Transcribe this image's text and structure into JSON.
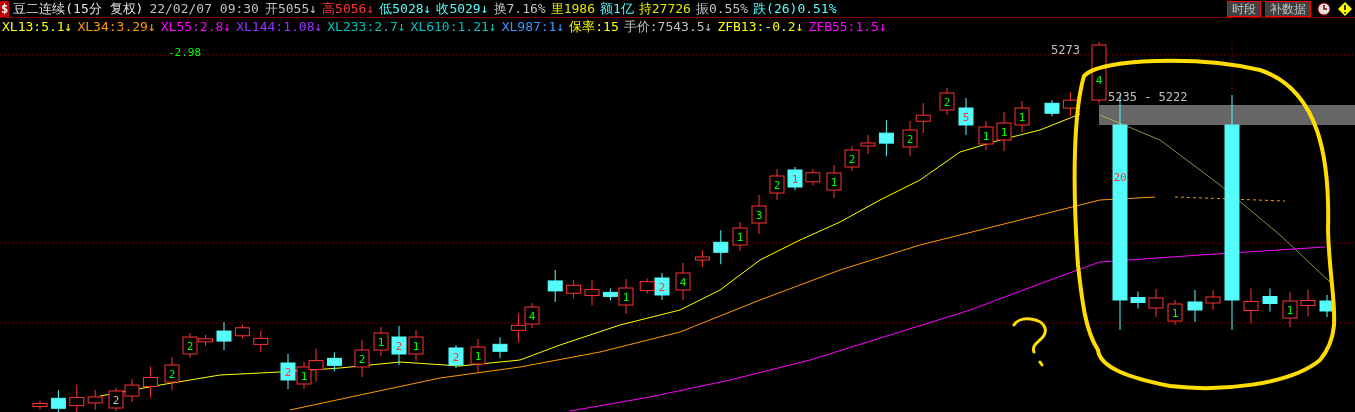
{
  "header": {
    "badge": "$",
    "title": "豆二连续(15分 复权)",
    "datetime": "22/02/07 09:30",
    "quotes": [
      {
        "text": "开5055",
        "arrow": "↓",
        "color": "#c0c0c0"
      },
      {
        "text": "高5056",
        "arrow": "↓",
        "color": "#ff3232"
      },
      {
        "text": "低5028",
        "arrow": "↓",
        "color": "#54fcfc"
      },
      {
        "text": "收5029",
        "arrow": "↓",
        "color": "#54fcfc"
      },
      {
        "text": "换7.16%",
        "color": "#c0c0c0"
      },
      {
        "text": "里1986",
        "color": "#e6e600"
      },
      {
        "text": "额1亿",
        "color": "#54fcfc"
      },
      {
        "text": "持27726",
        "color": "#e6e600"
      },
      {
        "text": "振0.55%",
        "color": "#c0c0c0"
      },
      {
        "text": "跌(26)0.51%",
        "color": "#54fcfc"
      }
    ],
    "buttons": [
      "时段",
      "补数据"
    ]
  },
  "indicators": [
    {
      "text": "XL13:5.1",
      "arrow": "↓",
      "color": "#ffff00"
    },
    {
      "text": "XL34:3.29",
      "arrow": "↓",
      "color": "#ff9900"
    },
    {
      "text": "XL55:2.8",
      "arrow": "↓",
      "color": "#ff00ff"
    },
    {
      "text": "XL144:1.08",
      "arrow": "↓",
      "color": "#9933ff"
    },
    {
      "text": "XL233:2.7",
      "arrow": "↓",
      "color": "#00c0c0"
    },
    {
      "text": "XL610:1.21",
      "arrow": "↓",
      "color": "#00c0c0"
    },
    {
      "text": "XL987:1",
      "arrow": "↓",
      "color": "#3399ff"
    },
    {
      "text": "保率:15",
      "color": "#ffff00"
    },
    {
      "text": "手价:7543.5",
      "arrow": "↓",
      "color": "#c0c0c0"
    },
    {
      "text": "ZFB13:-0.2",
      "arrow": "↓",
      "color": "#ffff00"
    },
    {
      "text": "ZFB55:1.5",
      "arrow": "↓",
      "color": "#ff00ff"
    }
  ],
  "chart": {
    "change_value": "-2.98",
    "high_label": "5273",
    "range_label": "5235 - 5222",
    "candle_labels": [
      {
        "text": "2",
        "kind": "flat"
      },
      {
        "text": "2",
        "kind": "up"
      },
      {
        "text": "2",
        "kind": "up"
      },
      {
        "text": "2",
        "kind": "down"
      },
      {
        "text": "1",
        "kind": "up"
      },
      {
        "text": "2",
        "kind": "up"
      },
      {
        "text": "1",
        "kind": "up"
      },
      {
        "text": "2",
        "kind": "down"
      },
      {
        "text": "1",
        "kind": "up"
      },
      {
        "text": "2",
        "kind": "down"
      },
      {
        "text": "1",
        "kind": "up"
      },
      {
        "text": "4",
        "kind": "up"
      },
      {
        "text": "1",
        "kind": "up"
      },
      {
        "text": "2",
        "kind": "down"
      },
      {
        "text": "4",
        "kind": "up"
      },
      {
        "text": "1",
        "kind": "up"
      },
      {
        "text": "3",
        "kind": "up"
      },
      {
        "text": "2",
        "kind": "up"
      },
      {
        "text": "1",
        "kind": "down"
      },
      {
        "text": "1",
        "kind": "up"
      },
      {
        "text": "2",
        "kind": "up"
      },
      {
        "text": "2",
        "kind": "up"
      },
      {
        "text": "2",
        "kind": "up"
      },
      {
        "text": "5",
        "kind": "down"
      },
      {
        "text": "1",
        "kind": "up"
      },
      {
        "text": "1",
        "kind": "up"
      },
      {
        "text": "1",
        "kind": "up"
      },
      {
        "text": "4",
        "kind": "up"
      },
      {
        "text": "20",
        "kind": "down"
      },
      {
        "text": "1",
        "kind": "up"
      },
      {
        "text": "1",
        "kind": "up"
      }
    ]
  }
}
